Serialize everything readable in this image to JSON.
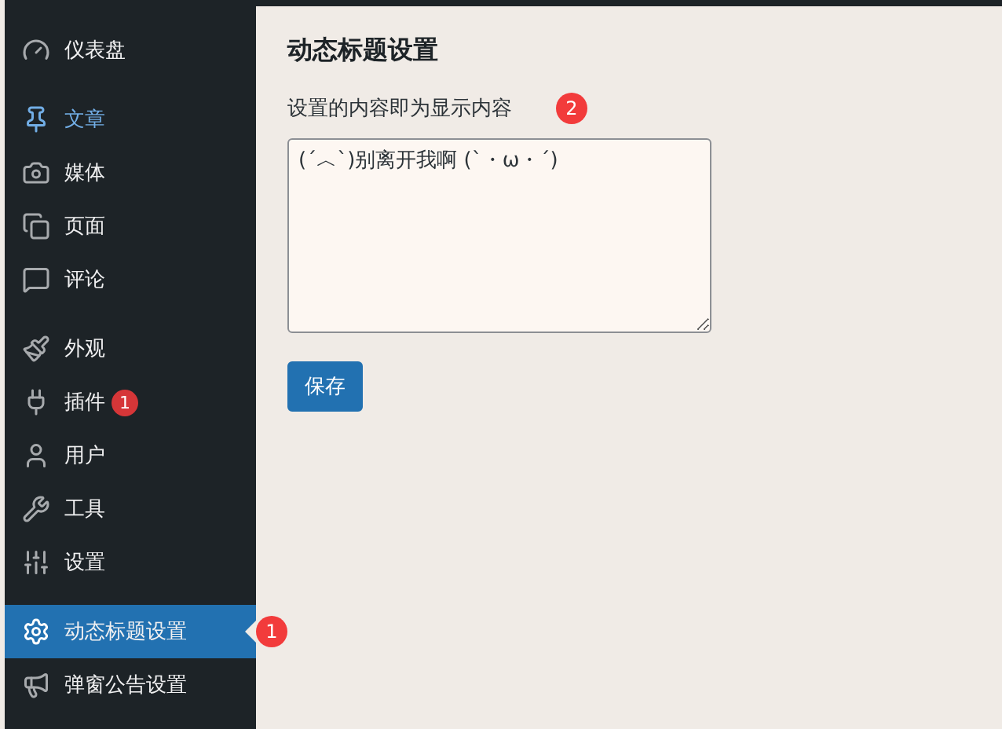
{
  "sidebar": {
    "groups": [
      [
        {
          "label": "仪表盘",
          "selected": false,
          "highlighted": false
        }
      ],
      [
        {
          "label": "文章",
          "selected": false,
          "highlighted": true
        },
        {
          "label": "媒体",
          "selected": false,
          "highlighted": false
        },
        {
          "label": "页面",
          "selected": false,
          "highlighted": false
        },
        {
          "label": "评论",
          "selected": false,
          "highlighted": false
        }
      ],
      [
        {
          "label": "外观",
          "selected": false,
          "highlighted": false
        },
        {
          "label": "插件",
          "selected": false,
          "highlighted": false,
          "badge": "1"
        },
        {
          "label": "用户",
          "selected": false,
          "highlighted": false
        },
        {
          "label": "工具",
          "selected": false,
          "highlighted": false
        },
        {
          "label": "设置",
          "selected": false,
          "highlighted": false
        }
      ],
      [
        {
          "label": "动态标题设置",
          "selected": true,
          "highlighted": false,
          "marker": "1"
        },
        {
          "label": "弹窗公告设置",
          "selected": false,
          "highlighted": false
        }
      ]
    ]
  },
  "main": {
    "title": "动态标题设置",
    "description": "设置的内容即为显示内容",
    "description_marker": "2",
    "textarea_value": "(ˊ︿ˋ)别离开我啊 (ˋ・ω・ˊ)",
    "save_button": "保存"
  }
}
